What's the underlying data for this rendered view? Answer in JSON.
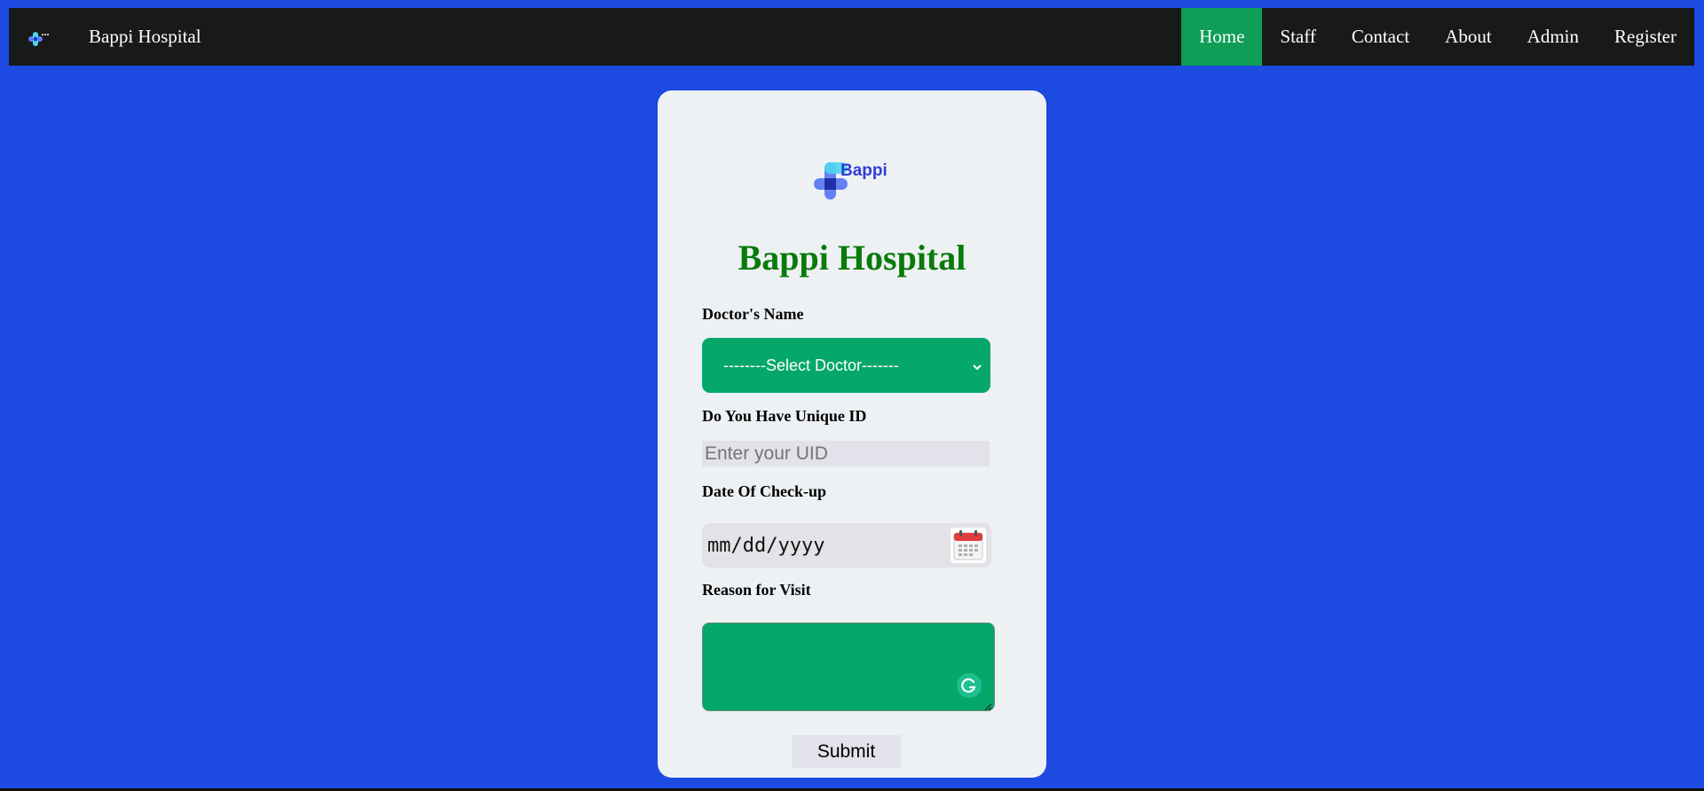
{
  "navbar": {
    "brand": "Bappi Hospital",
    "links": [
      {
        "label": "Home",
        "active": true
      },
      {
        "label": "Staff",
        "active": false
      },
      {
        "label": "Contact",
        "active": false
      },
      {
        "label": "About",
        "active": false
      },
      {
        "label": "Admin",
        "active": false
      },
      {
        "label": "Register",
        "active": false
      }
    ]
  },
  "form": {
    "logo_text": "Bappi",
    "title": "Bappi Hospital",
    "doctor_label": "Doctor's Name",
    "doctor_select_value": "--------Select Doctor-------",
    "uid_label": "Do You Have Unique ID",
    "uid_placeholder": "Enter your UID",
    "date_label": "Date Of Check-up",
    "date_placeholder": "mm/dd/yyyy",
    "reason_label": "Reason for Visit",
    "submit_label": "Submit"
  },
  "colors": {
    "page_background": "#1d4ae0",
    "navbar_background": "#181a19",
    "active_nav": "#0f9d58",
    "card_background": "#eef1f4",
    "title_green": "#0a7a0a",
    "field_green": "#05a86a",
    "input_gray": "#e2e2ea"
  },
  "icons": {
    "nav_logo": "hospital-cross-logo-icon",
    "select_arrow": "chevron-down-icon",
    "date_picker": "calendar-icon",
    "grammar": "grammarly-icon",
    "resize": "resize-handle-icon"
  }
}
